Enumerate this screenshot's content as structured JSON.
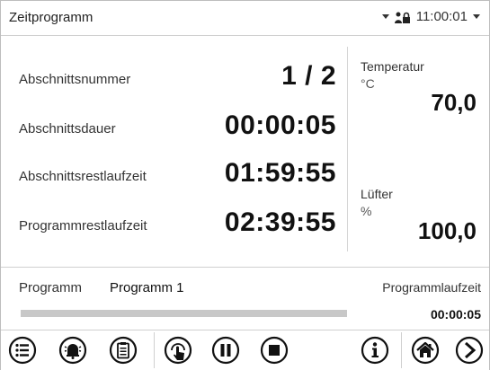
{
  "header": {
    "title": "Zeitprogramm",
    "time": "11:00:01"
  },
  "main": {
    "rows": [
      {
        "label": "Abschnittsnummer",
        "value": "1 / 2"
      },
      {
        "label": "Abschnittsdauer",
        "value": "00:00:05"
      },
      {
        "label": "Abschnittsrestlaufzeit",
        "value": "01:59:55"
      },
      {
        "label": "Programmrestlaufzeit",
        "value": "02:39:55"
      }
    ],
    "temperature": {
      "label": "Temperatur",
      "unit": "°C",
      "value": "70,0"
    },
    "fan": {
      "label": "Lüfter",
      "unit": "%",
      "value": "100,0"
    }
  },
  "program": {
    "label": "Programm",
    "name": "Programm 1",
    "runtime_label": "Programmlaufzeit",
    "runtime_value": "00:00:05",
    "progress": 0
  },
  "toolbar": {
    "icons": [
      "menu-icon",
      "alarm-icon",
      "clipboard-icon",
      "touch-control-icon",
      "pause-icon",
      "stop-icon",
      "info-icon",
      "home-icon",
      "next-icon"
    ]
  },
  "colors": {
    "progress_track": "#c8c8c8",
    "icon": "#111111"
  }
}
